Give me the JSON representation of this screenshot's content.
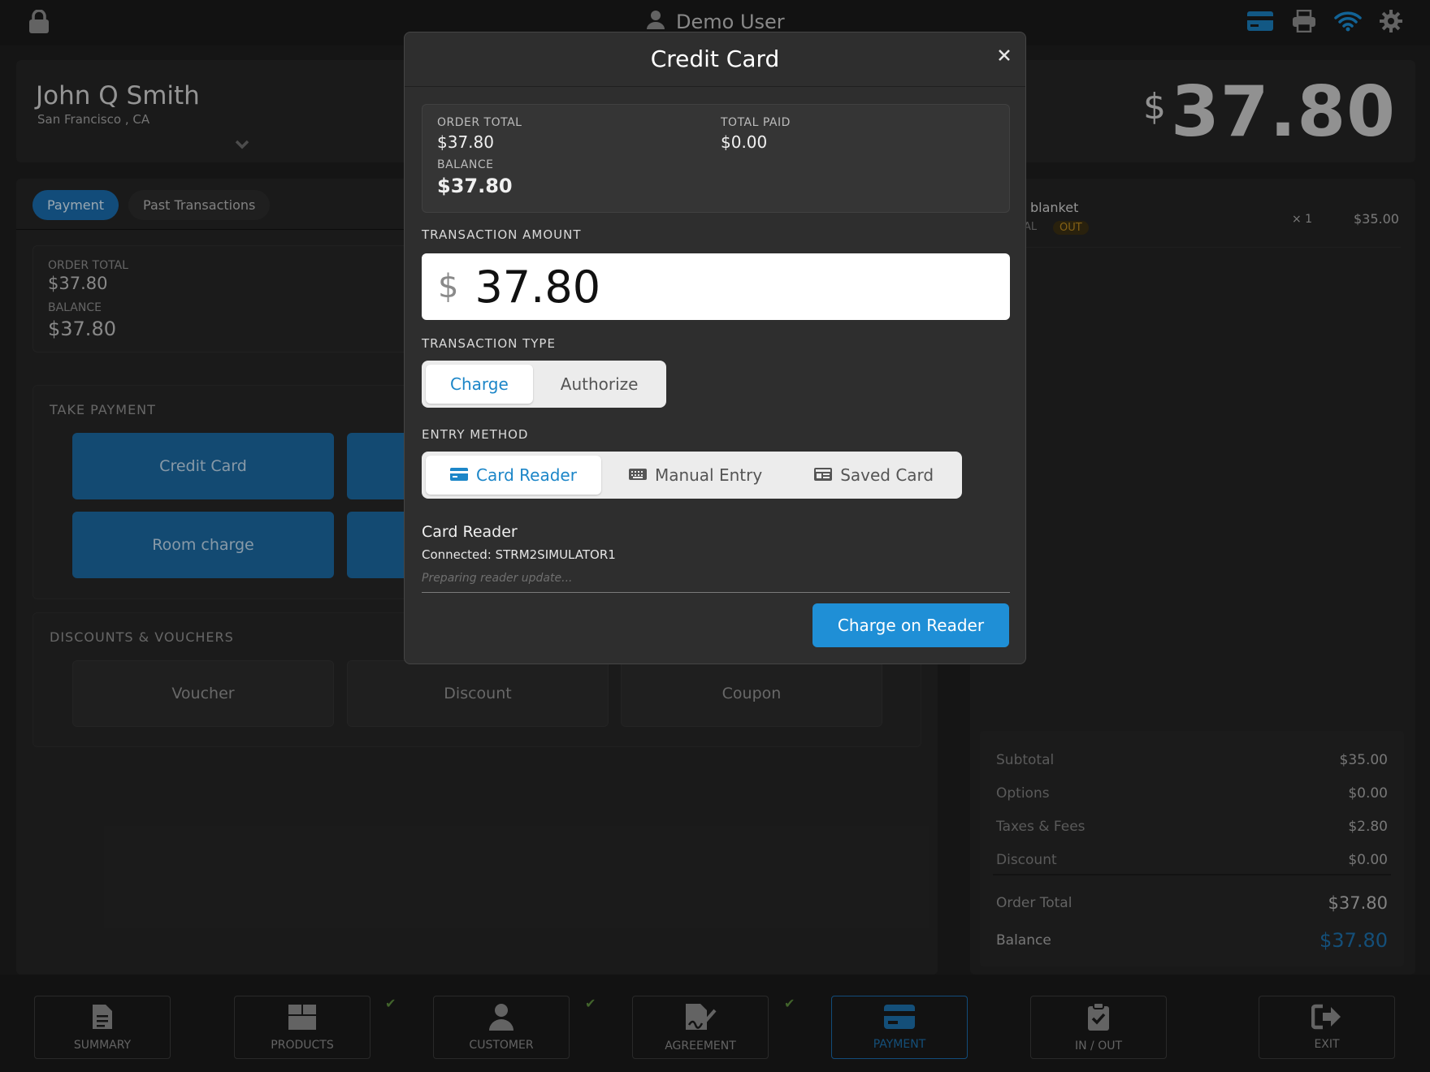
{
  "topbar": {
    "user": "Demo User",
    "icons": [
      "lock-icon",
      "user-icon",
      "credit-card-icon",
      "printer-icon",
      "wifi-icon",
      "gear-icon"
    ]
  },
  "customer": {
    "name": "John Q Smith",
    "location": "San Francisco , CA"
  },
  "header_total": {
    "currency": "$",
    "amount": "37.80"
  },
  "tabs": [
    {
      "label": "Payment",
      "active": true
    },
    {
      "label": "Past Transactions",
      "active": false
    }
  ],
  "summary": {
    "order_total_label": "ORDER TOTAL",
    "order_total": "$37.80",
    "balance_label": "BALANCE",
    "balance": "$37.80"
  },
  "take_payment": {
    "title": "TAKE PAYMENT",
    "buttons": [
      "Credit Card",
      "",
      "Room charge",
      ""
    ]
  },
  "discounts": {
    "title": "DISCOUNTS & VOUCHERS",
    "buttons": [
      "Voucher",
      "Discount",
      "Coupon"
    ]
  },
  "order_item": {
    "name": "blanket",
    "tag1": "AL",
    "tag2": "OUT",
    "qty": "× 1",
    "price": "$35.00"
  },
  "totals": [
    {
      "label": "Subtotal",
      "value": "$35.00"
    },
    {
      "label": "Options",
      "value": "$0.00"
    },
    {
      "label": "Taxes & Fees",
      "value": "$2.80"
    },
    {
      "label": "Discount",
      "value": "$0.00"
    }
  ],
  "order_total": {
    "label": "Order Total",
    "value": "$37.80"
  },
  "balance": {
    "label": "Balance",
    "value": "$37.80"
  },
  "nav": [
    {
      "label": "SUMMARY",
      "icon": "document-icon",
      "checked": false,
      "active": false
    },
    {
      "label": "PRODUCTS",
      "icon": "box-icon",
      "checked": true,
      "active": false
    },
    {
      "label": "CUSTOMER",
      "icon": "person-icon",
      "checked": true,
      "active": false
    },
    {
      "label": "AGREEMENT",
      "icon": "signature-icon",
      "checked": true,
      "active": false
    },
    {
      "label": "PAYMENT",
      "icon": "credit-card-icon",
      "checked": false,
      "active": true
    },
    {
      "label": "IN / OUT",
      "icon": "clipboard-check-icon",
      "checked": false,
      "active": false
    },
    {
      "label": "EXIT",
      "icon": "exit-icon",
      "checked": false,
      "active": false
    }
  ],
  "modal": {
    "title": "Credit Card",
    "order_total_label": "ORDER TOTAL",
    "order_total": "$37.80",
    "total_paid_label": "TOTAL PAID",
    "total_paid": "$0.00",
    "balance_label": "BALANCE",
    "balance": "$37.80",
    "transaction_amount_label": "TRANSACTION AMOUNT",
    "currency": "$",
    "amount": "37.80",
    "transaction_type_label": "TRANSACTION TYPE",
    "transaction_types": [
      "Charge",
      "Authorize"
    ],
    "selected_type": "Charge",
    "entry_method_label": "ENTRY METHOD",
    "entry_methods": [
      "Card Reader",
      "Manual Entry",
      "Saved Card"
    ],
    "selected_method": "Card Reader",
    "card_reader_title": "Card Reader",
    "card_reader_status": "Connected: STRM2SIMULATOR1",
    "reader_placeholder": "Preparing reader update...",
    "submit_label": "Charge on Reader"
  },
  "colors": {
    "accent": "#1f8fd6",
    "balance_blue": "#1c6ea8",
    "check_green": "#5a8a3c",
    "out_tag": "#b8871e"
  }
}
